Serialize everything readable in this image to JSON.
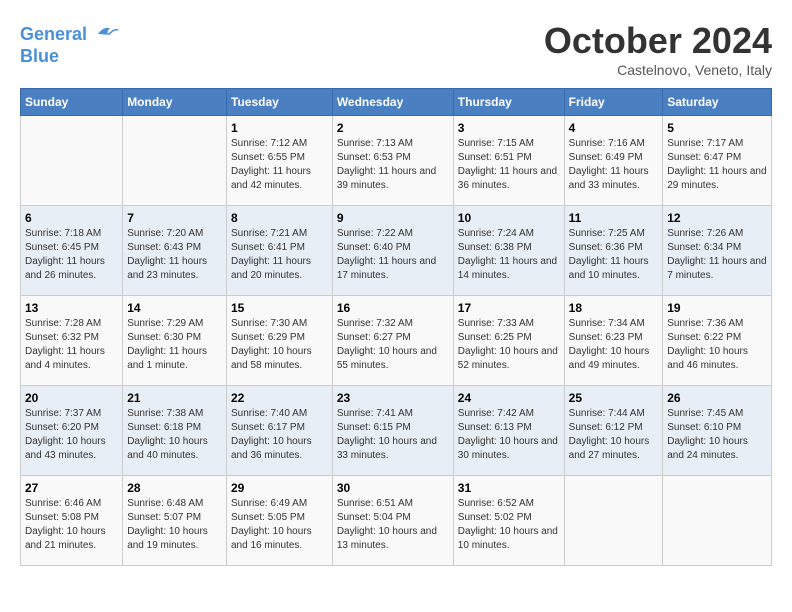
{
  "header": {
    "logo_line1": "General",
    "logo_line2": "Blue",
    "month": "October 2024",
    "location": "Castelnovo, Veneto, Italy"
  },
  "days_of_week": [
    "Sunday",
    "Monday",
    "Tuesday",
    "Wednesday",
    "Thursday",
    "Friday",
    "Saturday"
  ],
  "weeks": [
    [
      {
        "day": "",
        "info": ""
      },
      {
        "day": "",
        "info": ""
      },
      {
        "day": "1",
        "info": "Sunrise: 7:12 AM\nSunset: 6:55 PM\nDaylight: 11 hours and 42 minutes."
      },
      {
        "day": "2",
        "info": "Sunrise: 7:13 AM\nSunset: 6:53 PM\nDaylight: 11 hours and 39 minutes."
      },
      {
        "day": "3",
        "info": "Sunrise: 7:15 AM\nSunset: 6:51 PM\nDaylight: 11 hours and 36 minutes."
      },
      {
        "day": "4",
        "info": "Sunrise: 7:16 AM\nSunset: 6:49 PM\nDaylight: 11 hours and 33 minutes."
      },
      {
        "day": "5",
        "info": "Sunrise: 7:17 AM\nSunset: 6:47 PM\nDaylight: 11 hours and 29 minutes."
      }
    ],
    [
      {
        "day": "6",
        "info": "Sunrise: 7:18 AM\nSunset: 6:45 PM\nDaylight: 11 hours and 26 minutes."
      },
      {
        "day": "7",
        "info": "Sunrise: 7:20 AM\nSunset: 6:43 PM\nDaylight: 11 hours and 23 minutes."
      },
      {
        "day": "8",
        "info": "Sunrise: 7:21 AM\nSunset: 6:41 PM\nDaylight: 11 hours and 20 minutes."
      },
      {
        "day": "9",
        "info": "Sunrise: 7:22 AM\nSunset: 6:40 PM\nDaylight: 11 hours and 17 minutes."
      },
      {
        "day": "10",
        "info": "Sunrise: 7:24 AM\nSunset: 6:38 PM\nDaylight: 11 hours and 14 minutes."
      },
      {
        "day": "11",
        "info": "Sunrise: 7:25 AM\nSunset: 6:36 PM\nDaylight: 11 hours and 10 minutes."
      },
      {
        "day": "12",
        "info": "Sunrise: 7:26 AM\nSunset: 6:34 PM\nDaylight: 11 hours and 7 minutes."
      }
    ],
    [
      {
        "day": "13",
        "info": "Sunrise: 7:28 AM\nSunset: 6:32 PM\nDaylight: 11 hours and 4 minutes."
      },
      {
        "day": "14",
        "info": "Sunrise: 7:29 AM\nSunset: 6:30 PM\nDaylight: 11 hours and 1 minute."
      },
      {
        "day": "15",
        "info": "Sunrise: 7:30 AM\nSunset: 6:29 PM\nDaylight: 10 hours and 58 minutes."
      },
      {
        "day": "16",
        "info": "Sunrise: 7:32 AM\nSunset: 6:27 PM\nDaylight: 10 hours and 55 minutes."
      },
      {
        "day": "17",
        "info": "Sunrise: 7:33 AM\nSunset: 6:25 PM\nDaylight: 10 hours and 52 minutes."
      },
      {
        "day": "18",
        "info": "Sunrise: 7:34 AM\nSunset: 6:23 PM\nDaylight: 10 hours and 49 minutes."
      },
      {
        "day": "19",
        "info": "Sunrise: 7:36 AM\nSunset: 6:22 PM\nDaylight: 10 hours and 46 minutes."
      }
    ],
    [
      {
        "day": "20",
        "info": "Sunrise: 7:37 AM\nSunset: 6:20 PM\nDaylight: 10 hours and 43 minutes."
      },
      {
        "day": "21",
        "info": "Sunrise: 7:38 AM\nSunset: 6:18 PM\nDaylight: 10 hours and 40 minutes."
      },
      {
        "day": "22",
        "info": "Sunrise: 7:40 AM\nSunset: 6:17 PM\nDaylight: 10 hours and 36 minutes."
      },
      {
        "day": "23",
        "info": "Sunrise: 7:41 AM\nSunset: 6:15 PM\nDaylight: 10 hours and 33 minutes."
      },
      {
        "day": "24",
        "info": "Sunrise: 7:42 AM\nSunset: 6:13 PM\nDaylight: 10 hours and 30 minutes."
      },
      {
        "day": "25",
        "info": "Sunrise: 7:44 AM\nSunset: 6:12 PM\nDaylight: 10 hours and 27 minutes."
      },
      {
        "day": "26",
        "info": "Sunrise: 7:45 AM\nSunset: 6:10 PM\nDaylight: 10 hours and 24 minutes."
      }
    ],
    [
      {
        "day": "27",
        "info": "Sunrise: 6:46 AM\nSunset: 5:08 PM\nDaylight: 10 hours and 21 minutes."
      },
      {
        "day": "28",
        "info": "Sunrise: 6:48 AM\nSunset: 5:07 PM\nDaylight: 10 hours and 19 minutes."
      },
      {
        "day": "29",
        "info": "Sunrise: 6:49 AM\nSunset: 5:05 PM\nDaylight: 10 hours and 16 minutes."
      },
      {
        "day": "30",
        "info": "Sunrise: 6:51 AM\nSunset: 5:04 PM\nDaylight: 10 hours and 13 minutes."
      },
      {
        "day": "31",
        "info": "Sunrise: 6:52 AM\nSunset: 5:02 PM\nDaylight: 10 hours and 10 minutes."
      },
      {
        "day": "",
        "info": ""
      },
      {
        "day": "",
        "info": ""
      }
    ]
  ]
}
